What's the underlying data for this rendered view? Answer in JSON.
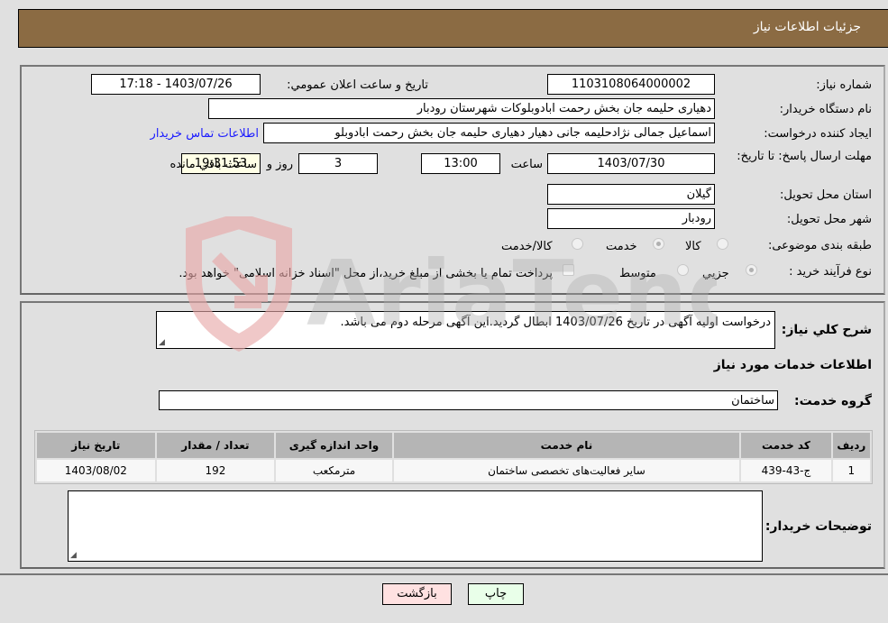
{
  "header": {
    "title": "جزئیات اطلاعات نیاز"
  },
  "fields": {
    "need_number": {
      "label": "شماره نیاز:",
      "value": "1103108064000002"
    },
    "announce_datetime": {
      "label": "تاریخ و ساعت اعلان عمومي:",
      "value": "1403/07/26 - 17:18"
    },
    "buyer_org": {
      "label": "نام دستگاه خریدار:",
      "value": "دهیاری حلیمه جان بخش رحمت ابادوبلوکات شهرستان رودبار"
    },
    "requester": {
      "label": "ایجاد کننده درخواست:",
      "value": "اسماعیل جمالی نژادحلیمه جانی دهیار دهیاری حلیمه جان بخش رحمت ابادوبلو"
    },
    "buyer_contact_link": "اطلاعات تماس خریدار",
    "deadline": {
      "label": "مهلت ارسال پاسخ: تا تاریخ:",
      "date": "1403/07/30",
      "time_label": "ساعت",
      "time": "13:00",
      "days": "3",
      "days_label": "روز و",
      "remaining": "19:31:53",
      "remaining_label": "ساعت باقي مانده"
    },
    "province": {
      "label": "استان محل تحویل:",
      "value": "گیلان"
    },
    "city": {
      "label": "شهر محل تحویل:",
      "value": "رودبار"
    },
    "category": {
      "label": "طبقه بندی موضوعی:",
      "options": [
        "کالا",
        "خدمت",
        "کالا/خدمت"
      ],
      "selected": "خدمت"
    },
    "purchase_type": {
      "label": "نوع فرآیند خرید :",
      "options": [
        "جزيي",
        "متوسط"
      ],
      "selected": "جزيي",
      "treasury_note": "پرداخت تمام یا بخشی از مبلغ خرید،از محل \"اسناد خزانه اسلامی\" خواهد بود.",
      "treasury_checked": false
    }
  },
  "details": {
    "summary_label": "شرح كلي نیاز:",
    "summary_value": "درخواست اولیه آگهی در تاریخ 1403/07/26 ابطال گردید.این آگهی مرحله دوم می باشد.",
    "services_title": "اطلاعات خدمات مورد نیاز",
    "service_group_label": "گروه خدمت:",
    "service_group_value": "ساختمان",
    "table": {
      "headers": [
        "ردیف",
        "کد خدمت",
        "نام خدمت",
        "واحد اندازه گیری",
        "تعداد / مقدار",
        "تاریخ نیاز"
      ],
      "rows": [
        [
          "1",
          "ج-43-439",
          "سایر فعالیت‌های تخصصی ساختمان",
          "مترمکعب",
          "192",
          "1403/08/02"
        ]
      ]
    },
    "buyer_notes_label": "توضیحات خریدار:",
    "buyer_notes_value": ""
  },
  "buttons": {
    "print": "چاپ",
    "back": "بازگشت"
  },
  "watermark": {
    "text": "AriaTender.neT"
  }
}
